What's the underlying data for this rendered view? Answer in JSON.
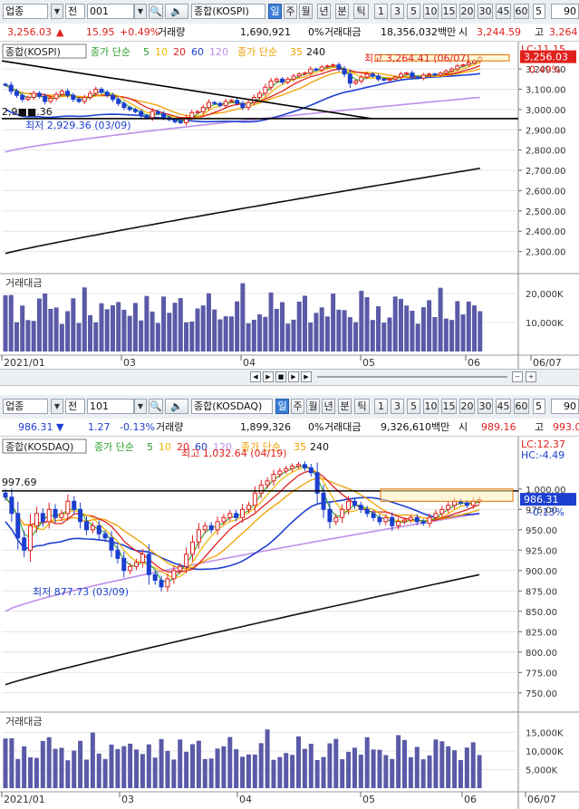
{
  "panel1": {
    "toolbar": {
      "market": "업종",
      "type": "전",
      "code": "001",
      "name": "종합(KOSPI)",
      "periods": [
        "일",
        "주",
        "월",
        "년",
        "분",
        "틱"
      ],
      "selected_period": "일",
      "intervals": [
        "1",
        "3",
        "5",
        "10",
        "15",
        "20",
        "30",
        "45",
        "60"
      ],
      "count_field": "5",
      "view_count": "90"
    },
    "info": {
      "price": "3,256.03",
      "direction": "▲",
      "change": "15.95",
      "change_pct": "+0.49%",
      "volume_label": "거래량",
      "volume": "1,690,921",
      "zero_pct": "0%",
      "amount_label": "거래대금",
      "amount": "18,356,032백만",
      "open_label": "시",
      "open": "3,244.59",
      "high_label": "고",
      "high": "3,264"
    },
    "legend": {
      "name": "종합(KOSPI)",
      "ma_label": "종가 단순",
      "ma_periods": [
        "5",
        "10",
        "20",
        "60",
        "120"
      ],
      "ma2_label": "종가 단순",
      "ma2_periods": [
        "35",
        "240"
      ]
    },
    "annotations": {
      "high": "최고 3,264.41 (06/07)",
      "low": "최저 2,929.36 (03/09)",
      "line_level": "2,9■■.36",
      "lc": "LC:11.15",
      "current": "3,256.03",
      "current_pct": "0.49%"
    },
    "volume_title": "거래대금",
    "volume_ticks": [
      "20,000K",
      "10,000K"
    ],
    "date_labels": [
      "2021/01",
      "03",
      "04",
      "05",
      "06",
      "06/07"
    ]
  },
  "panel2": {
    "toolbar": {
      "market": "업종",
      "type": "전",
      "code": "101",
      "name": "종합(KOSDAQ)",
      "periods": [
        "일",
        "주",
        "월",
        "년",
        "분",
        "틱"
      ],
      "selected_period": "일",
      "intervals": [
        "1",
        "3",
        "5",
        "10",
        "15",
        "20",
        "30",
        "45",
        "60"
      ],
      "count_field": "5",
      "view_count": "90"
    },
    "info": {
      "price": "986.31",
      "direction": "▼",
      "change": "1.27",
      "change_pct": "-0.13%",
      "volume_label": "거래량",
      "volume": "1,899,326",
      "zero_pct": "0%",
      "amount_label": "거래대금",
      "amount": "9,326,610백만",
      "open_label": "시",
      "open": "989.16",
      "high_label": "고",
      "high": "993.0"
    },
    "legend": {
      "name": "종합(KOSDAQ)",
      "ma_label": "종가 단순",
      "ma_periods": [
        "5",
        "10",
        "20",
        "60",
        "120"
      ],
      "ma2_label": "종가 단순",
      "ma2_periods": [
        "35",
        "240"
      ]
    },
    "annotations": {
      "high": "최고 1,032.64 (04/19)",
      "low": "최저 877.73 (03/09)",
      "line_level": "997.69",
      "lc": "LC:12.37",
      "hc": "HC:-4.49",
      "current": "986.31",
      "current_pct": "-0.13%"
    },
    "volume_title": "거래대금",
    "volume_ticks": [
      "15,000K",
      "10,000K",
      "5,000K"
    ],
    "date_labels": [
      "2021/01",
      "03",
      "04",
      "05",
      "06",
      "06/07"
    ]
  },
  "chart_data": [
    {
      "type": "candlestick",
      "title": "종합(KOSPI)",
      "y_ticks": [
        3200,
        3100,
        3000,
        2900,
        2800,
        2700,
        2600,
        2500,
        2400,
        2300
      ],
      "ylim": [
        2240,
        3290
      ],
      "x_labels": [
        "2021/01",
        "03",
        "04",
        "05",
        "06"
      ],
      "high": {
        "value": 3264.41,
        "date": "06/07"
      },
      "low": {
        "value": 2929.36,
        "date": "03/09"
      },
      "last": 3256.03,
      "ma_colors": {
        "5": "#2ca02c",
        "10": "#f0b400",
        "20": "#e02020",
        "60": "#1f3fd0",
        "120": "#c08ee8",
        "35": "#f0a000",
        "240": "#111111"
      },
      "closes": [
        3120,
        3090,
        3070,
        3050,
        3060,
        3080,
        3065,
        3040,
        3055,
        3075,
        3090,
        3070,
        3050,
        3040,
        3060,
        3080,
        3100,
        3085,
        3070,
        3050,
        3030,
        3010,
        3000,
        2990,
        2970,
        2960,
        2990,
        2980,
        2960,
        2950,
        2940,
        2935,
        2960,
        2985,
        2990,
        3010,
        3035,
        3030,
        3020,
        3040,
        3045,
        3030,
        3010,
        3035,
        3060,
        3080,
        3110,
        3140,
        3150,
        3135,
        3150,
        3165,
        3175,
        3180,
        3200,
        3195,
        3210,
        3215,
        3220,
        3200,
        3175,
        3130,
        3140,
        3160,
        3175,
        3165,
        3150,
        3145,
        3150,
        3160,
        3175,
        3180,
        3160,
        3155,
        3170,
        3175,
        3170,
        3180,
        3190,
        3200,
        3215,
        3220,
        3230,
        3240,
        3256
      ],
      "volume_max": 25000,
      "volume_ticks": [
        20000,
        10000
      ]
    },
    {
      "type": "candlestick",
      "title": "종합(KOSDAQ)",
      "y_ticks": [
        1000,
        975,
        950,
        925,
        900,
        875,
        850,
        825,
        800,
        775,
        750
      ],
      "ylim": [
        742,
        1042
      ],
      "x_labels": [
        "2021/01",
        "03",
        "04",
        "05",
        "06"
      ],
      "high": {
        "value": 1032.64,
        "date": "04/19"
      },
      "low": {
        "value": 877.73,
        "date": "03/09"
      },
      "last": 986.31,
      "ma_colors": {
        "5": "#2ca02c",
        "10": "#f0b400",
        "20": "#e02020",
        "60": "#1f3fd0",
        "120": "#c08ee8",
        "35": "#f0a000",
        "240": "#111111"
      },
      "closes": [
        990,
        970,
        940,
        925,
        955,
        970,
        960,
        975,
        965,
        970,
        985,
        975,
        960,
        950,
        955,
        945,
        940,
        925,
        915,
        900,
        905,
        910,
        920,
        895,
        888,
        880,
        890,
        900,
        905,
        920,
        935,
        950,
        955,
        950,
        960,
        965,
        970,
        965,
        975,
        980,
        995,
        1005,
        1010,
        1018,
        1022,
        1025,
        1028,
        1030,
        1026,
        1020,
        995,
        975,
        960,
        965,
        975,
        985,
        980,
        975,
        970,
        965,
        960,
        965,
        955,
        960,
        962,
        965,
        960,
        958,
        965,
        970,
        975,
        980,
        985,
        983,
        980,
        985,
        987
      ],
      "volume_max": 19000,
      "volume_ticks": [
        15000,
        10000,
        5000
      ]
    }
  ]
}
